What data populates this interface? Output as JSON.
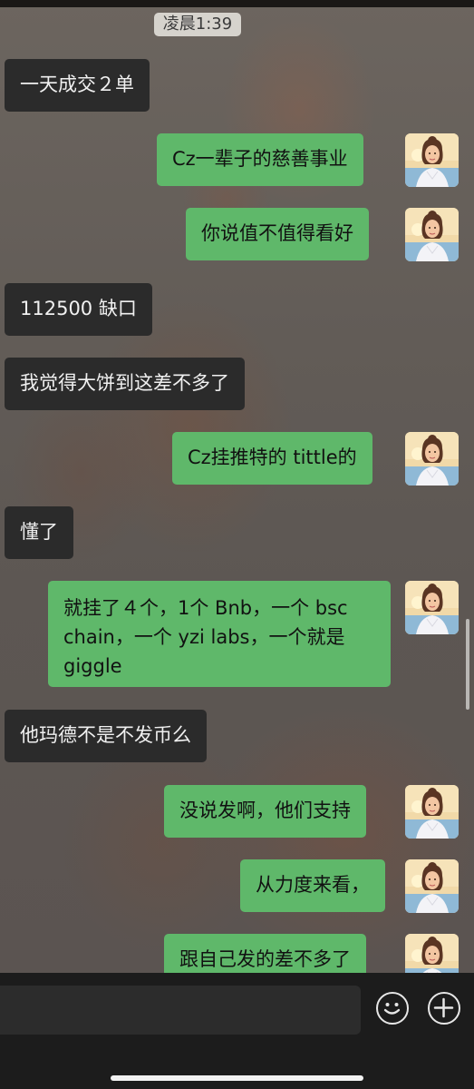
{
  "header": {
    "time": "凌晨1:39"
  },
  "messages": [
    {
      "side": "left",
      "text": "一天成交２单"
    },
    {
      "side": "right",
      "text": "Cz一辈子的慈善事业"
    },
    {
      "side": "right",
      "text": "你说值不值得看好"
    },
    {
      "side": "left",
      "text": "112500 缺口"
    },
    {
      "side": "left",
      "text": "我觉得大饼到这差不多了"
    },
    {
      "side": "right",
      "text": "Cz挂推特的 tittle的"
    },
    {
      "side": "left",
      "text": "懂了"
    },
    {
      "side": "right",
      "text": "就挂了４个，1个 Bnb，一个 bsc chain，一个 yzi labs，一个就是 giggle"
    },
    {
      "side": "left",
      "text": "他玛德不是不发币么"
    },
    {
      "side": "right",
      "text": "没说发啊，他们支持"
    },
    {
      "side": "right",
      "text": "从力度来看，"
    },
    {
      "side": "right",
      "text": "跟自己发的差不多了"
    }
  ],
  "input_bar": {
    "emoji_icon": "emoji-icon",
    "plus_icon": "plus-icon"
  },
  "colors": {
    "sent_bubble": "#5fb86a",
    "received_bubble": "#2b2b2b",
    "input_bar": "#1c1c1c"
  }
}
